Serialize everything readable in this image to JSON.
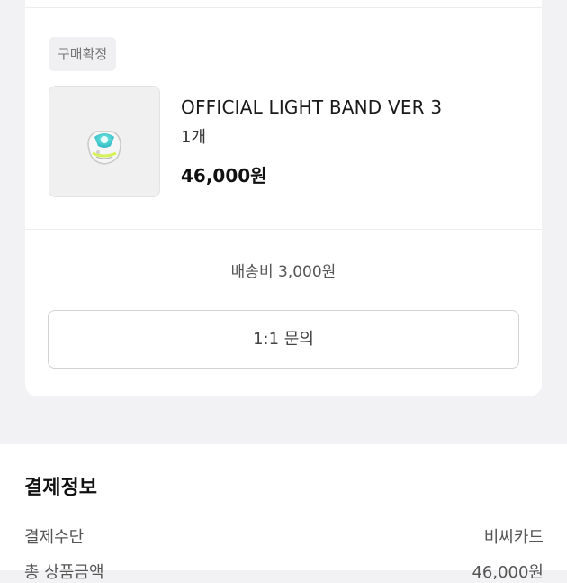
{
  "order": {
    "status_badge": "구매확정",
    "product": {
      "name": "OFFICIAL LIGHT BAND VER 3",
      "quantity": "1개",
      "price": "46,000원"
    },
    "shipping_fee": "배송비 3,000원",
    "inquiry_button": "1:1 문의"
  },
  "payment": {
    "title": "결제정보",
    "rows": [
      {
        "label": "결제수단",
        "value": "비씨카드"
      },
      {
        "label": "총 상품금액",
        "value": "46,000원"
      }
    ]
  }
}
